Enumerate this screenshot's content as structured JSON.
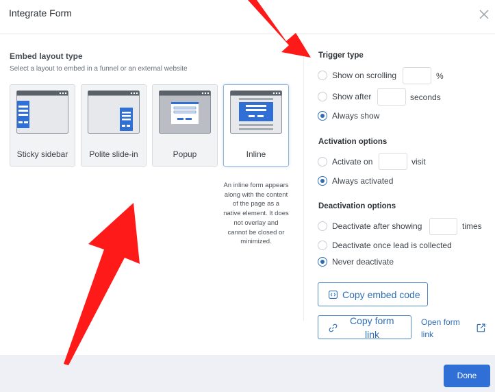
{
  "header": {
    "title": "Integrate Form",
    "close_icon": "close-icon"
  },
  "layout": {
    "title": "Embed layout type",
    "subtitle": "Select a layout to embed in a funnel or an external website",
    "cards": [
      {
        "label": "Sticky sidebar",
        "selected": false
      },
      {
        "label": "Polite slide-in",
        "selected": false
      },
      {
        "label": "Popup",
        "selected": false
      },
      {
        "label": "Inline",
        "selected": true
      }
    ],
    "description": "An inline form appears along with the content of the page as a native element. It does not overlay and cannot be closed or minimized."
  },
  "trigger": {
    "title": "Trigger type",
    "options": [
      {
        "label": "Show on scrolling",
        "unit": "%",
        "selected": false
      },
      {
        "label": "Show after",
        "unit": "seconds",
        "selected": false
      },
      {
        "label": "Always show",
        "selected": true
      }
    ]
  },
  "activation": {
    "title": "Activation options",
    "options": [
      {
        "label": "Activate on",
        "unit": "visit",
        "selected": false
      },
      {
        "label": "Always activated",
        "selected": true
      }
    ]
  },
  "deactivation": {
    "title": "Deactivation options",
    "options": [
      {
        "label": "Deactivate after showing",
        "unit": "times",
        "selected": false
      },
      {
        "label": "Deactivate once lead is collected",
        "selected": false
      },
      {
        "label": "Never deactivate",
        "selected": true
      }
    ]
  },
  "actions": {
    "copy_embed": "Copy embed code",
    "copy_link_line1": "Copy form",
    "copy_link_line2": "link",
    "open_link_line1": "Open form",
    "open_link_line2": "link",
    "done": "Done"
  },
  "colors": {
    "accent": "#2f6db3",
    "primary_button": "#2f6fd6",
    "annotation_arrow": "#ff1a1a"
  }
}
